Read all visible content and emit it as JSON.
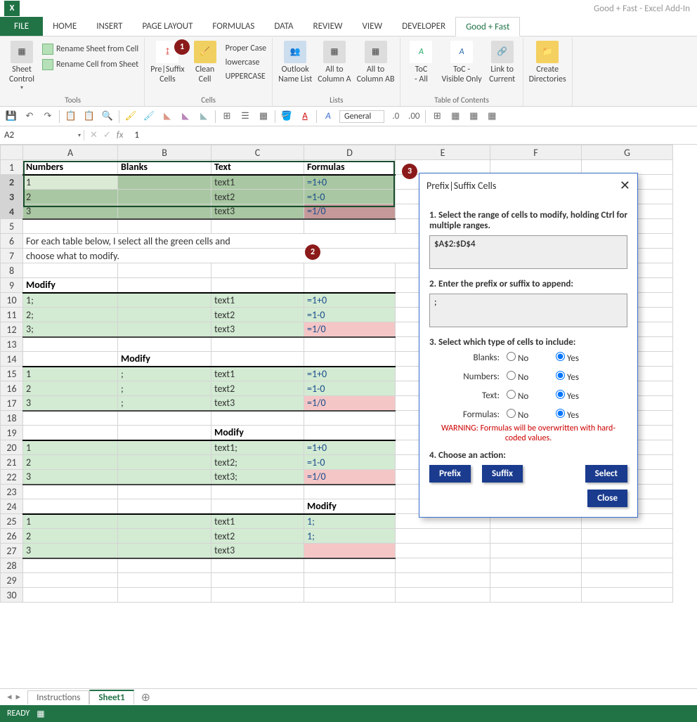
{
  "app": {
    "title": "Good + Fast - Excel Add-In"
  },
  "tabs": [
    "FILE",
    "HOME",
    "INSERT",
    "PAGE LAYOUT",
    "FORMULAS",
    "DATA",
    "REVIEW",
    "VIEW",
    "DEVELOPER",
    "Good + Fast"
  ],
  "active_tab": "Good + Fast",
  "ribbon": {
    "groups": [
      {
        "label": "Tools",
        "large": [
          {
            "caption": "Sheet\nControl"
          }
        ],
        "small": [
          {
            "caption": "Rename Sheet from Cell"
          },
          {
            "caption": "Rename Cell from Sheet"
          }
        ]
      },
      {
        "label": "Cells",
        "large": [
          {
            "caption": "Pre|Suffix\nCells"
          },
          {
            "caption": "Clean\nCell"
          }
        ],
        "small": [
          {
            "caption": "Proper Case"
          },
          {
            "caption": "lowercase"
          },
          {
            "caption": "UPPERCASE"
          }
        ]
      },
      {
        "label": "Lists",
        "large": [
          {
            "caption": "Outlook\nName List"
          },
          {
            "caption": "All to\nColumn A"
          },
          {
            "caption": "All to\nColumn AB"
          }
        ],
        "small": []
      },
      {
        "label": "Table of Contents",
        "large": [
          {
            "caption": "ToC\n - All"
          },
          {
            "caption": "ToC -\nVisible Only"
          },
          {
            "caption": "Link to\nCurrent"
          }
        ],
        "small": []
      },
      {
        "label": "",
        "large": [
          {
            "caption": "Create\nDirectories"
          }
        ],
        "small": []
      }
    ]
  },
  "qat_number_format": "General",
  "namebox": "A2",
  "formula": "1",
  "columns": [
    "A",
    "B",
    "C",
    "D",
    "E",
    "F",
    "G"
  ],
  "sheet": {
    "headers": {
      "A": "Numbers",
      "B": "Blanks",
      "C": "Text",
      "D": "Formulas"
    },
    "r2": {
      "A": "1",
      "C": "text1",
      "D": "=1+0"
    },
    "r3": {
      "A": "2",
      "C": "text2",
      "D": "=1-0"
    },
    "r4": {
      "A": "3",
      "C": "text3",
      "D": "=1/0"
    },
    "r6": "For each table below, I select all the green cells and",
    "r7": "choose what to modify.",
    "r9A": "Modify",
    "r10": {
      "A": "1;",
      "C": "text1",
      "D": "=1+0"
    },
    "r11": {
      "A": "2;",
      "C": "text2",
      "D": "=1-0"
    },
    "r12": {
      "A": "3;",
      "C": "text3",
      "D": "=1/0"
    },
    "r14B": "Modify",
    "r15": {
      "A": "1",
      "B": ";",
      "C": "text1",
      "D": "=1+0"
    },
    "r16": {
      "A": "2",
      "B": ";",
      "C": "text2",
      "D": "=1-0"
    },
    "r17": {
      "A": "3",
      "B": ";",
      "C": "text3",
      "D": "=1/0"
    },
    "r19C": "Modify",
    "r20": {
      "A": "1",
      "C": "text1;",
      "D": "=1+0"
    },
    "r21": {
      "A": "2",
      "C": "text2;",
      "D": "=1-0"
    },
    "r22": {
      "A": "3",
      "C": "text3;",
      "D": "=1/0"
    },
    "r24D": "Modify",
    "r25": {
      "A": "1",
      "C": "text1",
      "D": "1;"
    },
    "r26": {
      "A": "2",
      "C": "text2",
      "D": "1;"
    },
    "r27": {
      "A": "3",
      "C": "text3",
      "D": ""
    }
  },
  "dialog": {
    "title": "Prefix|Suffix Cells",
    "step1": "1. Select the range of cells to modify, holding Ctrl for multiple ranges.",
    "range": "$A$2:$D$4",
    "step2": "2. Enter the prefix or suffix to append:",
    "suffix_value": ";",
    "step3": "3. Select which type of cells to include:",
    "radio_labels": {
      "blanks": "Blanks:",
      "numbers": "Numbers:",
      "text": "Text:",
      "formulas": "Formulas:"
    },
    "no": "No",
    "yes": "Yes",
    "warn": "WARNING: Formulas will be overwritten with hard-coded values.",
    "step4": "4. Choose an action:",
    "btn_prefix": "Prefix",
    "btn_suffix": "Suffix",
    "btn_select": "Select",
    "btn_close": "Close"
  },
  "callouts": {
    "c1": "1",
    "c2": "2",
    "c3": "3"
  },
  "sheet_tabs": {
    "instructions": "Instructions",
    "sheet1": "Sheet1"
  },
  "status": "READY"
}
